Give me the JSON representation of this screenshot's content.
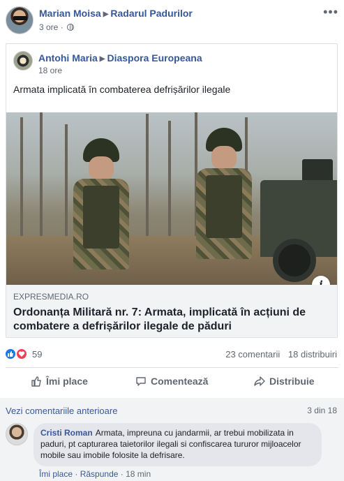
{
  "post": {
    "author": "Marian Moisa",
    "group": "Radarul Padurilor",
    "time": "3 ore",
    "more_label": "•••"
  },
  "shared": {
    "author": "Antohi Maria",
    "group": "Diaspora Europeana",
    "time": "18 ore",
    "text": "Armata implicată în combaterea defrișărilor ilegale",
    "link": {
      "source": "EXPRESMEDIA.RO",
      "title": "Ordonanța Militară nr. 7: Armata, implicată în acțiuni de combatere a defrișărilor ilegale de păduri",
      "info_glyph": "i"
    }
  },
  "stats": {
    "reactions_count": "59",
    "comments": "23 comentarii",
    "shares": "18 distribuiri"
  },
  "actions": {
    "like": "Îmi place",
    "comment": "Comentează",
    "share": "Distribuie"
  },
  "comments": {
    "previous_link": "Vezi comentariile anterioare",
    "page_count": "3 din 18",
    "items": [
      {
        "author": "Cristi Roman",
        "text": "Armata, impreuna cu jandarmii, ar trebui mobilizata in paduri, pt capturarea taietorilor ilegali si confiscarea tururor mijloacelor mobile sau imobile folosite la defrisare.",
        "like_label": "Îmi place",
        "reply_label": "Răspunde",
        "time": "18 min"
      }
    ]
  },
  "colors": {
    "link_blue": "#365899",
    "like_blue": "#1877f2",
    "love_red": "#f33e58",
    "secondary_text": "#606770"
  },
  "icons": [
    "globe-icon",
    "more-icon",
    "like-reaction-icon",
    "love-reaction-icon",
    "thumbs-up-icon",
    "comment-icon",
    "share-icon",
    "info-icon"
  ]
}
